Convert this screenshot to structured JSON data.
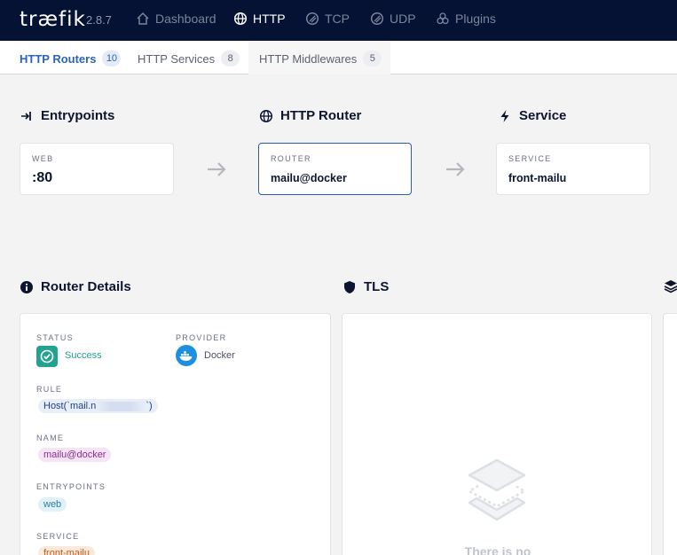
{
  "brand": {
    "logo": "træfik",
    "version": "2.8.7"
  },
  "nav": {
    "items": [
      {
        "label": "Dashboard",
        "icon": "home-icon"
      },
      {
        "label": "HTTP",
        "icon": "globe-icon"
      },
      {
        "label": "TCP",
        "icon": "tcp-icon"
      },
      {
        "label": "UDP",
        "icon": "udp-icon"
      },
      {
        "label": "Plugins",
        "icon": "plugins-icon"
      }
    ],
    "active": "HTTP"
  },
  "subnav": {
    "tabs": [
      {
        "label": "HTTP Routers",
        "count": "10"
      },
      {
        "label": "HTTP Services",
        "count": "8"
      },
      {
        "label": "HTTP Middlewares",
        "count": "5"
      }
    ],
    "active": "HTTP Routers"
  },
  "flow": {
    "entrypoints": {
      "title": "Entrypoints",
      "label": "WEB",
      "value": ":80"
    },
    "router": {
      "title": "HTTP Router",
      "label": "ROUTER",
      "value": "mailu@docker"
    },
    "service": {
      "title": "Service",
      "label": "SERVICE",
      "value": "front-mailu"
    }
  },
  "details": {
    "title": "Router Details",
    "status_label": "STATUS",
    "status_value": "Success",
    "provider_label": "PROVIDER",
    "provider_value": "Docker",
    "rule_label": "RULE",
    "rule_value_start": "Host(`mail.n",
    "rule_value_end": "`)",
    "name_label": "NAME",
    "name_value": "mailu@docker",
    "entrypoints_label": "ENTRYPOINTS",
    "entrypoints_value": "web",
    "service_label": "SERVICE",
    "service_value": "front-mailu"
  },
  "tls": {
    "title": "TLS",
    "empty_text": "There is no"
  },
  "colors": {
    "nav_bg": "#051233",
    "accent": "#2b63b8",
    "success": "#23a38f",
    "docker": "#1d8fe1"
  }
}
